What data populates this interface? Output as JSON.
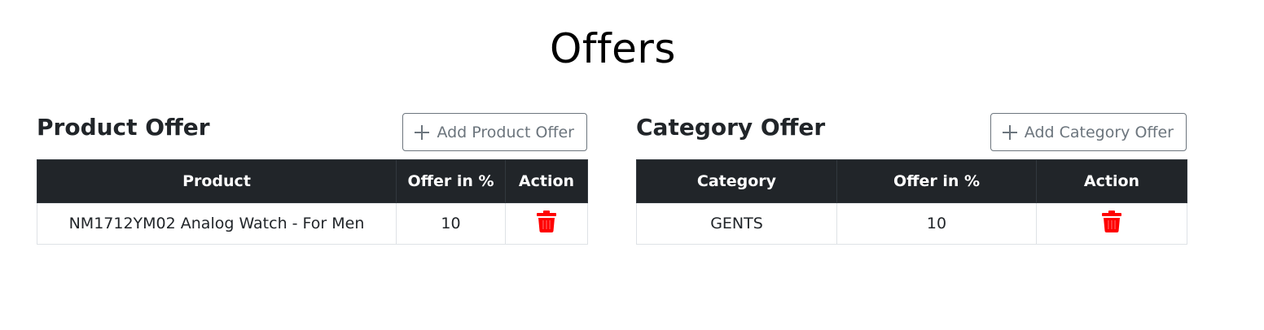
{
  "page": {
    "title": "Offers"
  },
  "product_offer": {
    "title": "Product Offer",
    "add_button_label": "Add Product Offer",
    "columns": [
      "Product",
      "Offer in %",
      "Action"
    ],
    "rows": [
      {
        "product": "NM1712YM02 Analog Watch - For Men",
        "offer": "10",
        "action_icon": "trash-icon"
      }
    ]
  },
  "category_offer": {
    "title": "Category Offer",
    "add_button_label": "Add Category Offer",
    "columns": [
      "Category",
      "Offer in %",
      "Action"
    ],
    "rows": [
      {
        "category": "GENTS",
        "offer": "10",
        "action_icon": "trash-icon"
      }
    ]
  },
  "colors": {
    "header_bg": "#212529",
    "delete_icon": "#ff0000",
    "button_outline": "#6c757d"
  }
}
